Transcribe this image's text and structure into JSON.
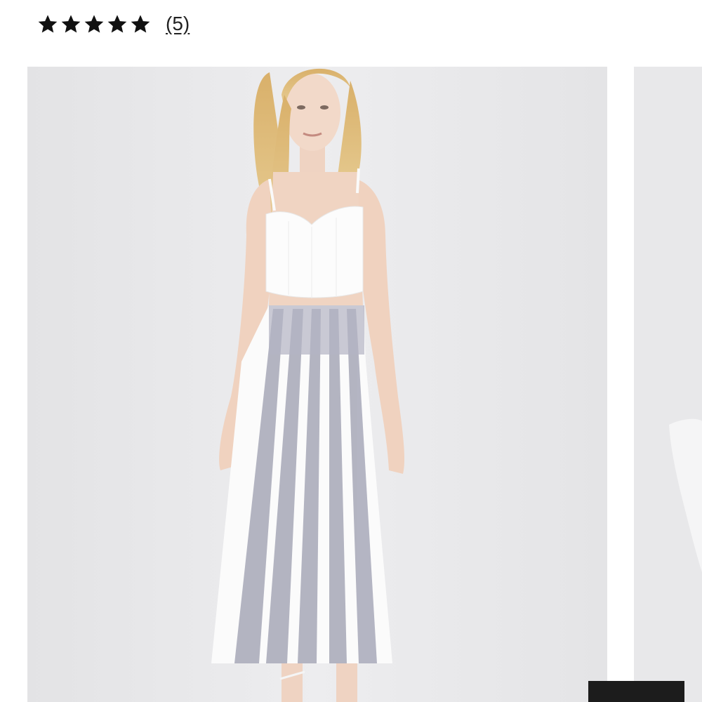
{
  "rating": {
    "stars": 5,
    "max_stars": 5,
    "review_count_label": "(5)"
  },
  "gallery": {
    "main_image_alt": "",
    "background_color": "#e6e6e8"
  },
  "colors": {
    "star": "#111111",
    "button": "#1c1c1c"
  }
}
